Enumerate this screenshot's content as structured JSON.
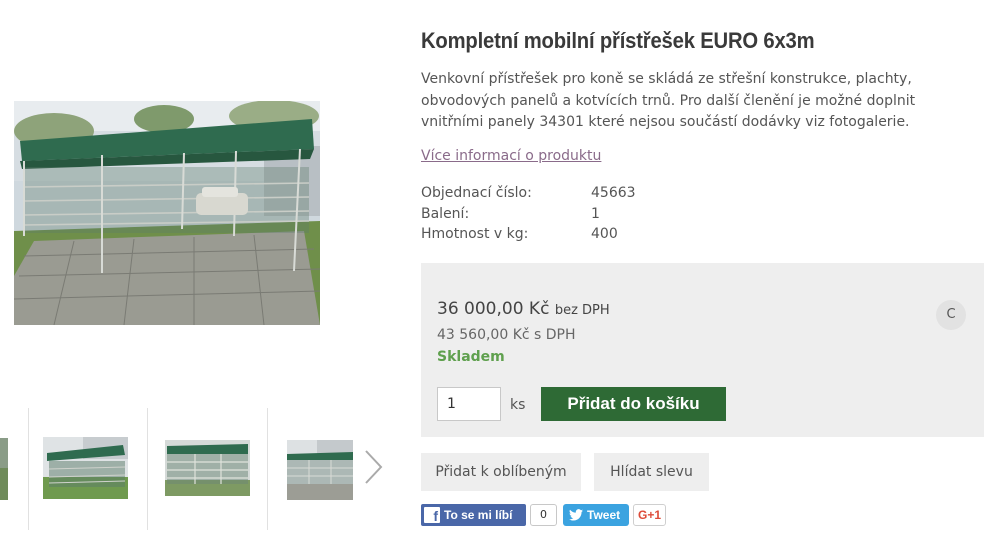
{
  "product": {
    "title": "Kompletní mobilní přístřešek EURO 6x3m",
    "description": "Venkovní přístřešek pro koně se skládá ze střešní konstrukce, plachty, obvodových panelů a kotvících trnů. Pro další členění je možné doplnit vnitřními panely 34301 které nejsou součástí dodávky viz fotogalerie.",
    "more_info_link": "Více informací o produktu",
    "params": [
      {
        "label": "Objednací číslo:",
        "value": "45663"
      },
      {
        "label": "Balení:",
        "value": "1"
      },
      {
        "label": "Hmotnost v kg:",
        "value": "400"
      }
    ]
  },
  "pricing": {
    "price_without_vat": "36 000,00 Kč",
    "price_without_vat_suffix": "bez DPH",
    "price_with_vat": "43 560,00 Kč s DPH",
    "stock_status": "Skladem",
    "compare_label": "C",
    "quantity_value": "1",
    "quantity_unit": "ks",
    "add_to_cart_label": "Přidat do košíku",
    "colors": {
      "cart_button": "#2e6a35",
      "stock_text": "#5fa04e",
      "box_bg": "#eeeeee"
    }
  },
  "actions": {
    "add_to_favorites": "Přidat k oblíbeným",
    "watch_discount": "Hlídat slevu"
  },
  "social": {
    "facebook_like_label": "To se mi líbí",
    "facebook_like_count": "0",
    "tweet_label": "Tweet",
    "gplus_label": "G+1"
  },
  "gallery": {
    "thumbnail_count": 4,
    "next_icon": "chevron-right-icon"
  }
}
